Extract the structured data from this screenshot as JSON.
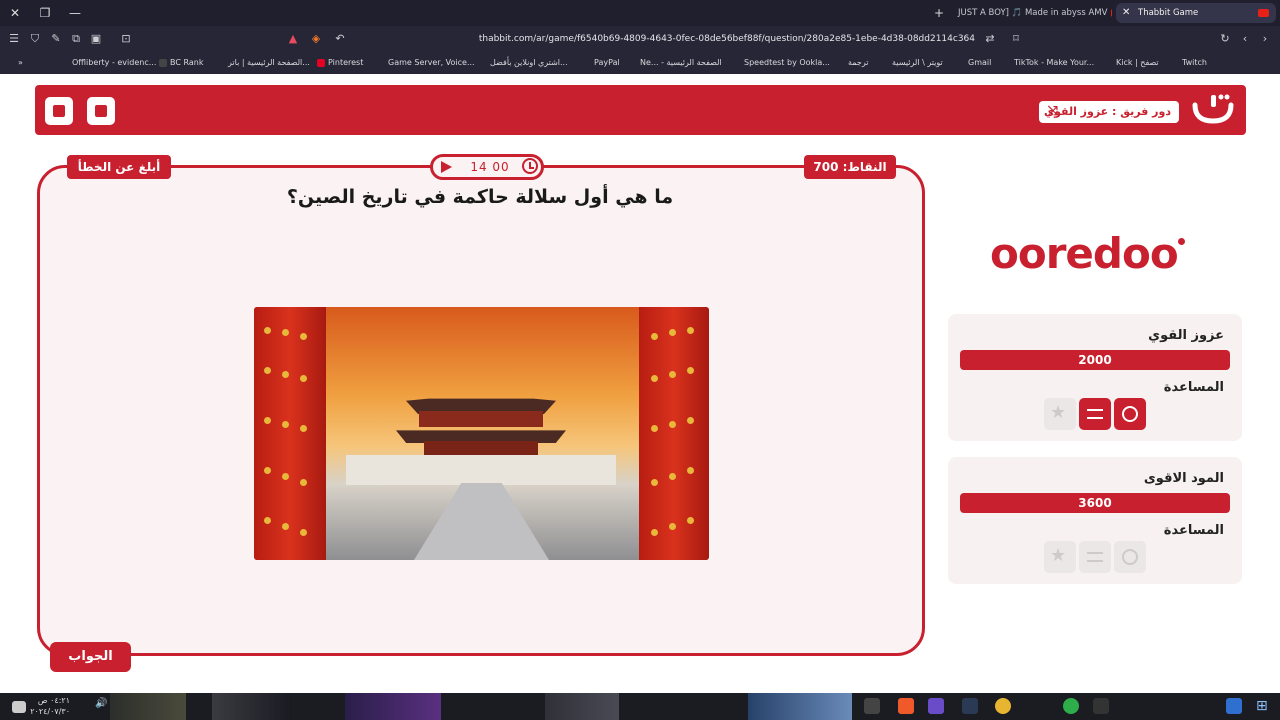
{
  "browser": {
    "tabs": [
      {
        "title": "JUST A BOY] 🎵 Made in abyss AMV",
        "active": false
      },
      {
        "title": "Thabbit Game",
        "active": true
      }
    ],
    "url": "thabbit.com/ar/game/f6540b69-4809-4643-0fec-08de56bef88f/question/280a2e85-1ebe-4d38-08dd2114c364",
    "bookmarks": [
      "Offliberty - evidenc...",
      "BC Rank",
      "الصفحة الرئيسية | باتر...",
      "Pinterest",
      "Game Server, Voice...",
      "اشتري اونلاين بأفضل...",
      "PayPal",
      "Ne... - الصفحة الرئيسية",
      "Speedtest by Ookla...",
      "ترجمة",
      "تويتر \\ الرئيسية",
      "Gmail",
      "TikTok - Make Your...",
      "Kick | تصفح",
      "Twitch"
    ]
  },
  "header": {
    "turn_label": "دور فريق : عزوز القوي",
    "logo_text": "ثبّت"
  },
  "question": {
    "report_label": "أبلغ عن الخطأ",
    "points_label": "النقاط: 700",
    "timer": "14 00",
    "text": "ما هي أول سلالة حاكمة في تاريخ الصين؟",
    "answer_label": "الجواب"
  },
  "sponsor": {
    "name": "ooredoo"
  },
  "teams": [
    {
      "name": "عزوز القوي",
      "score": "2000",
      "help_label": "المساعدة",
      "helps_enabled": true
    },
    {
      "name": "المود الاقوى",
      "score": "3600",
      "help_label": "المساعدة",
      "helps_enabled": false
    }
  ],
  "taskbar": {
    "time": "٠٤:٢١ ص",
    "date": "٢٠٢٤/٠٧/٣٠"
  },
  "colors": {
    "brand_red": "#c8202f",
    "card_bg": "#fbf3f3",
    "chrome_bg": "#262636"
  }
}
